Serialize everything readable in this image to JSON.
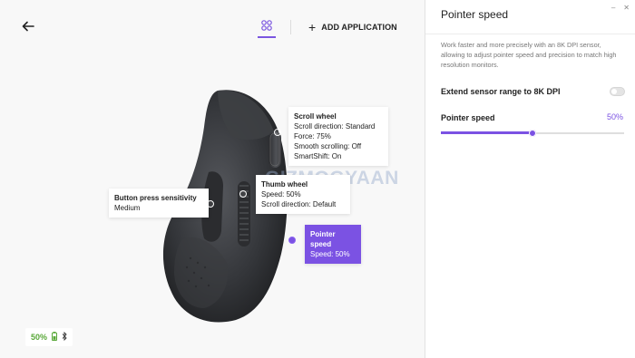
{
  "toolbar": {
    "add_application_label": "ADD APPLICATION"
  },
  "callouts": {
    "scroll_wheel": {
      "title": "Scroll wheel",
      "lines": [
        "Scroll direction: Standard",
        "Force: 75%",
        "Smooth scrolling: Off",
        "SmartShift: On"
      ]
    },
    "thumb_wheel": {
      "title": "Thumb wheel",
      "lines": [
        "Speed: 50%",
        "Scroll direction: Default"
      ]
    },
    "button_press": {
      "title": "Button press sensitivity",
      "lines": [
        "Medium"
      ]
    },
    "pointer_speed": {
      "title": "Pointer speed",
      "lines": [
        "Speed: 50%"
      ]
    }
  },
  "watermark": "GIZMOGYAAN",
  "battery": {
    "percent_label": "50%",
    "icons": [
      "battery-icon",
      "bluetooth-icon"
    ]
  },
  "panel": {
    "title": "Pointer speed",
    "description": "Work faster and more precisely with an 8K DPI sensor, allowing to adjust pointer speed and precision to match high resolution monitors.",
    "extend_label": "Extend sensor range to 8K DPI",
    "extend_enabled": false,
    "pointer_speed_label": "Pointer speed",
    "pointer_speed_value": "50%",
    "pointer_speed_fraction": 0.5
  },
  "colors": {
    "accent": "#7b52e3",
    "battery_green": "#5aa83a"
  }
}
